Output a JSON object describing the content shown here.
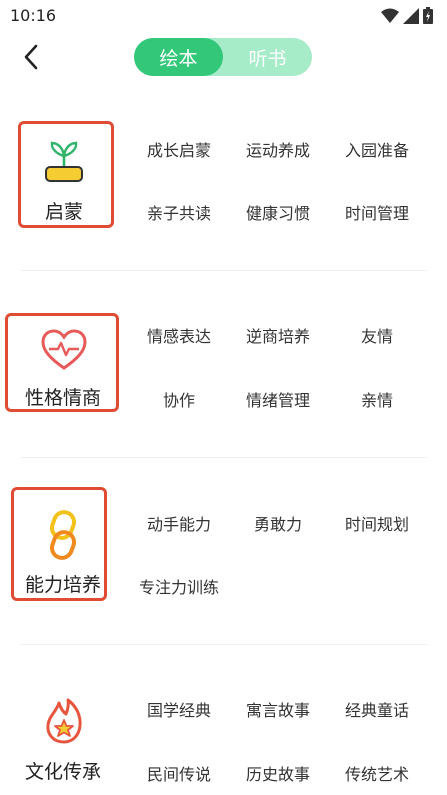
{
  "status": {
    "time": "10:16"
  },
  "tabs": [
    {
      "label": "绘本",
      "active": true
    },
    {
      "label": "听书",
      "active": false
    }
  ],
  "colors": {
    "accent": "#33c879",
    "accent_light": "#a6ecc9",
    "highlight_box": "#e04b33"
  },
  "sections": [
    {
      "title": "启蒙",
      "icon": "sprout-icon",
      "items": [
        "成长启蒙",
        "运动养成",
        "入园准备",
        "亲子共读",
        "健康习惯",
        "时间管理"
      ]
    },
    {
      "title": "性格情商",
      "icon": "heart-pulse-icon",
      "items": [
        "情感表达",
        "逆商培养",
        "友情",
        "协作",
        "情绪管理",
        "亲情"
      ]
    },
    {
      "title": "能力培养",
      "icon": "chain-link-icon",
      "items": [
        "动手能力",
        "勇敢力",
        "时间规划",
        "专注力训练"
      ]
    },
    {
      "title": "文化传承",
      "icon": "flame-star-icon",
      "items": [
        "国学经典",
        "寓言故事",
        "经典童话",
        "民间传说",
        "历史故事",
        "传统艺术"
      ]
    }
  ]
}
